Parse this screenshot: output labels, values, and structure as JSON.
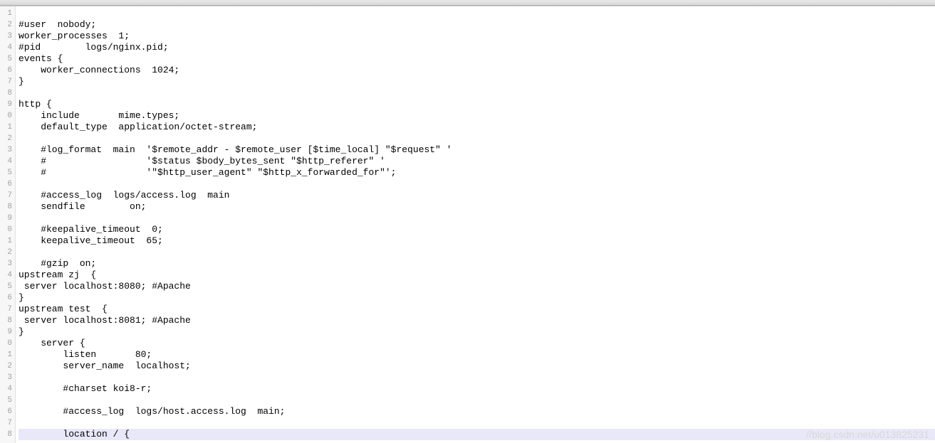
{
  "tabs": [
    {
      "label": ""
    },
    {
      "label": ""
    },
    {
      "label": ""
    },
    {
      "label": ""
    }
  ],
  "gutter": {
    "start": 1,
    "count": 38,
    "visible_digits": [
      "1",
      "2",
      "3",
      "4",
      "5",
      "6",
      "7",
      "8",
      "9",
      "0",
      "1",
      "2",
      "3",
      "4",
      "5",
      "6",
      "7",
      "8",
      "9",
      "0",
      "1",
      "2",
      "3",
      "4",
      "5",
      "6",
      "7",
      "8",
      "9",
      "0",
      "1",
      "2",
      "3",
      "4",
      "5",
      "6",
      "7",
      "8"
    ]
  },
  "code": {
    "lines": [
      "",
      "#user  nobody;",
      "worker_processes  1;",
      "#pid        logs/nginx.pid;",
      "events {",
      "    worker_connections  1024;",
      "}",
      "",
      "http {",
      "    include       mime.types;",
      "    default_type  application/octet-stream;",
      "",
      "    #log_format  main  '$remote_addr - $remote_user [$time_local] \"$request\" '",
      "    #                  '$status $body_bytes_sent \"$http_referer\" '",
      "    #                  '\"$http_user_agent\" \"$http_x_forwarded_for\"';",
      "",
      "    #access_log  logs/access.log  main",
      "    sendfile        on;",
      "",
      "    #keepalive_timeout  0;",
      "    keepalive_timeout  65;",
      "",
      "    #gzip  on;",
      "upstream zj  {",
      " server localhost:8080; #Apache",
      "}",
      "upstream test  {",
      " server localhost:8081; #Apache",
      "}",
      "    server {",
      "        listen       80;",
      "        server_name  localhost;",
      "",
      "        #charset koi8-r;",
      "",
      "        #access_log  logs/host.access.log  main;",
      "",
      "        location / {"
    ],
    "highlight_index": 37
  },
  "watermark": "//blog.csdn.net/u013825231"
}
